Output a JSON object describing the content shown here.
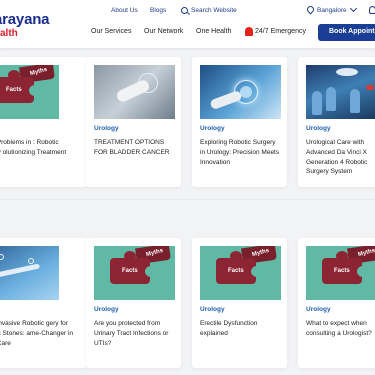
{
  "header": {
    "logo_text": "arayana",
    "logo_sub": "alth",
    "links": [
      "About Us",
      "Blogs"
    ],
    "search_label": "Search Website",
    "location": "Bangalore",
    "nav": [
      "Our Services",
      "Our Network",
      "One Health"
    ],
    "emergency": "24/7 Emergency",
    "cta": "Book Appointment",
    "brand_color": "#1a3d95",
    "alert_color": "#e2231a"
  },
  "cards_row1": [
    {
      "category": "ology",
      "title": "ogical Problems in : Robotic Surgery olutionizing Treatment comes",
      "image": "myths-facts-puzzle"
    },
    {
      "category": "Urology",
      "title": "TREATMENT OPTIONS FOR BLADDER CANCER",
      "image": "doctor-hand-hologram"
    },
    {
      "category": "Urology",
      "title": "Exploring Robotic Surgery in Urology: Precision Meets Innovation",
      "image": "digital-robot-hand"
    },
    {
      "category": "Urology",
      "title": "Urological Care with Advanced Da Vinci X Generation 4 Robotic Surgery System",
      "image": "surgery-team"
    }
  ],
  "cards_row2": [
    {
      "category": "ology",
      "title": "imally Invasive Robotic gery for Ureteric Stones: ame-Changer in ogical Care",
      "image": "robotic-arm"
    },
    {
      "category": "Urology",
      "title": "Are you protected from Urinary Tract Infections or UTIs?",
      "image": "myths-facts-puzzle"
    },
    {
      "category": "Urology",
      "title": "Erectile Dysfunction explained",
      "image": "myths-facts-puzzle"
    },
    {
      "category": "Urology",
      "title": "What to expect when consulting a Urologist?",
      "image": "myths-facts-puzzle"
    }
  ],
  "puzzle_labels": {
    "facts": "Facts",
    "myths": "Myths"
  }
}
